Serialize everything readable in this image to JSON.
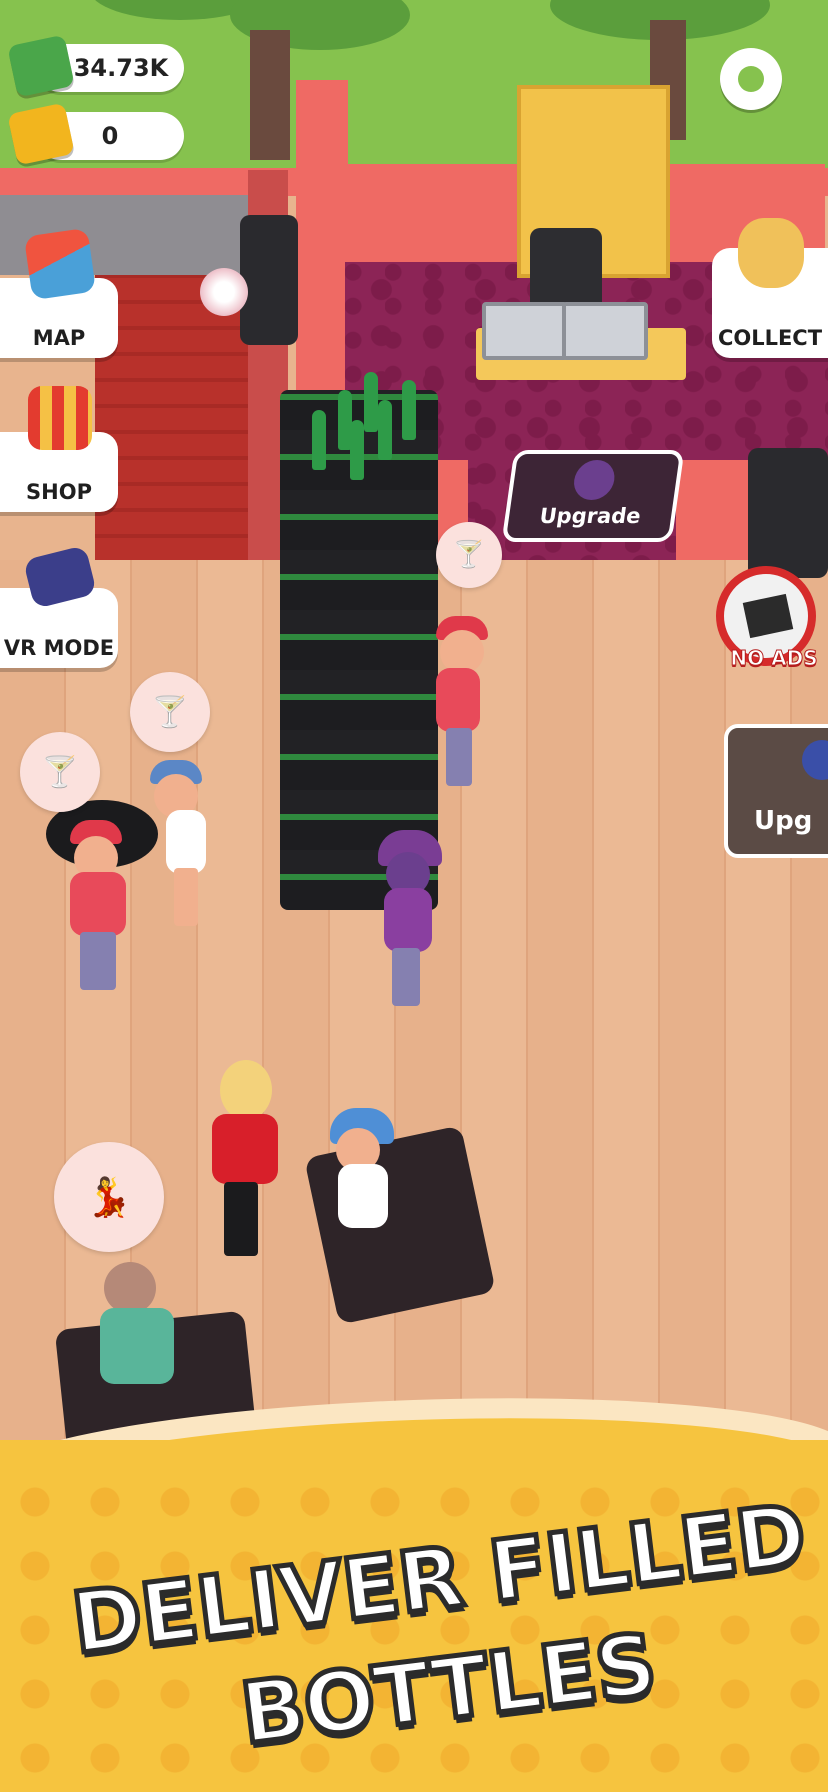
{
  "hud": {
    "cash_value": "34.73K",
    "ticket_value": "0"
  },
  "menu": {
    "map_label": "MAP",
    "shop_label": "SHOP",
    "vr_label": "VR MODE",
    "collect_label": "COLLECT",
    "no_ads_label": "NO ADS"
  },
  "scene": {
    "upgrade_pad_label": "Upgrade",
    "upgrade_pad2_label": "Upg"
  },
  "banner": {
    "line1": "DELIVER FILLED",
    "line2": "BOTTLES"
  },
  "colors": {
    "grass": "#86c24e",
    "wall": "#ef6a64",
    "carpet": "#8c2456",
    "floor": "#e7b18b",
    "banner": "#f6c43f"
  }
}
